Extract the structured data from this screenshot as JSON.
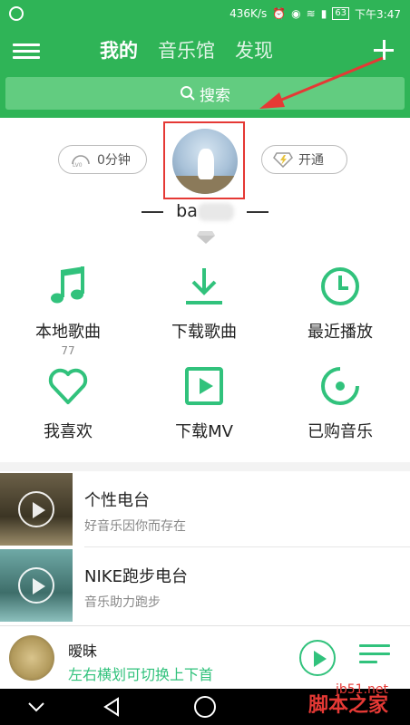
{
  "status_bar": {
    "speed": "436K/s",
    "battery": "63",
    "time": "下午3:47"
  },
  "header": {
    "tabs": [
      {
        "label": "我的",
        "active": true
      },
      {
        "label": "音乐馆",
        "active": false
      },
      {
        "label": "发现",
        "active": false
      }
    ],
    "search_label": "搜索"
  },
  "profile": {
    "listen_time": "0分钟",
    "vip_label": "开通",
    "username": "ba"
  },
  "grid": {
    "items": [
      {
        "label": "本地歌曲",
        "sub": "77",
        "icon": "music-note-icon"
      },
      {
        "label": "下载歌曲",
        "sub": "",
        "icon": "download-icon"
      },
      {
        "label": "最近播放",
        "sub": "",
        "icon": "clock-icon"
      },
      {
        "label": "我喜欢",
        "sub": "",
        "icon": "heart-icon"
      },
      {
        "label": "下载MV",
        "sub": "",
        "icon": "mv-play-icon"
      },
      {
        "label": "已购音乐",
        "sub": "",
        "icon": "purchased-music-icon"
      }
    ]
  },
  "radio_list": [
    {
      "title": "个性电台",
      "subtitle": "好音乐因你而存在"
    },
    {
      "title": "NIKE跑步电台",
      "subtitle": "音乐助力跑步"
    }
  ],
  "player": {
    "song_title": "暧昧",
    "hint": "左右横划可切换上下首"
  },
  "watermark": {
    "line1": "jb51.net",
    "line2": "脚本之家"
  },
  "colors": {
    "brand_green": "#31c27c",
    "header_green": "#2fb457",
    "annotation_red": "#e53935"
  }
}
